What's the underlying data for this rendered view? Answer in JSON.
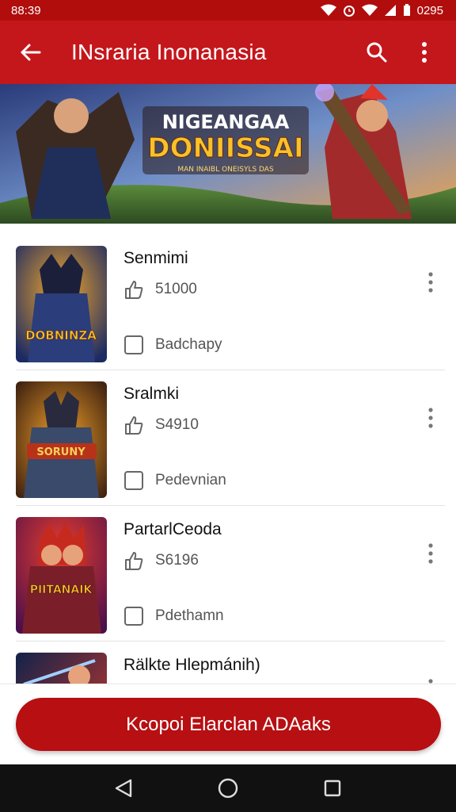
{
  "status_bar": {
    "time": "88:39",
    "right_text": "0295"
  },
  "app_bar": {
    "title": "INsraria Inonanasia"
  },
  "banner": {
    "title_line1": "NIGEANGAA",
    "title_line2": "DONIISSAI",
    "subtitle": "MAN INAIBL ONEISYLS DAS",
    "accent": "#f6c12b"
  },
  "items": [
    {
      "title": "Senmimi",
      "stat": "51000",
      "tag": "Badchapy",
      "thumb_text": "DOBNINZA",
      "thumb_colors": [
        "#1b2a63",
        "#e8482a"
      ]
    },
    {
      "title": "Sralmki",
      "stat": "S4910",
      "tag": "Pedevnian",
      "thumb_text": "SORUNY",
      "thumb_colors": [
        "#3a1e10",
        "#f2a22a"
      ]
    },
    {
      "title": "PartarlCeoda",
      "stat": "S6196",
      "tag": "Pdethamn",
      "thumb_text": "PIITANAIK",
      "thumb_colors": [
        "#4a0f4c",
        "#e73c2c"
      ]
    },
    {
      "title": "Rälkte Hlepmánih)",
      "stat": "",
      "tag": "",
      "thumb_text": "",
      "thumb_colors": [
        "#12224a",
        "#d33a2a"
      ]
    }
  ],
  "cta": {
    "label": "Kcopoi Elarclan ADAaks"
  },
  "colors": {
    "primary": "#c4171c",
    "primary_dark": "#b10d0d",
    "nav": "#111111"
  },
  "icons": {
    "app_bar": [
      "back-arrow-icon",
      "search-icon",
      "more-vert-icon"
    ],
    "row": [
      "like-icon",
      "checkbox-icon",
      "more-vert-icon"
    ],
    "nav": [
      "back-triangle-icon",
      "home-circle-icon",
      "recents-square-icon"
    ]
  }
}
